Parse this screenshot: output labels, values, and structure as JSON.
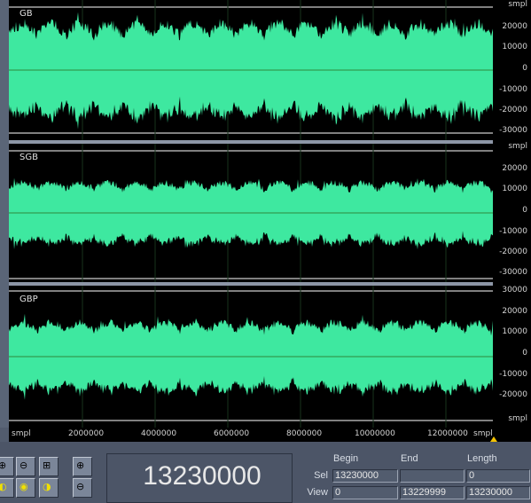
{
  "tracks": [
    {
      "label": "GB"
    },
    {
      "label": "SGB"
    },
    {
      "label": "GBP"
    }
  ],
  "right_ruler": {
    "track1": [
      "smpl",
      "20000",
      "10000",
      "0",
      "-10000",
      "-20000",
      "-30000"
    ],
    "track2": [
      "smpl",
      "20000",
      "10000",
      "0",
      "-10000",
      "-20000",
      "-30000"
    ],
    "track3": [
      "30000",
      "20000",
      "10000",
      "0",
      "-10000",
      "-20000",
      "smpl"
    ]
  },
  "bottom_ruler": [
    "smpl",
    "2000000",
    "4000000",
    "6000000",
    "8000000",
    "10000000",
    "12000000",
    "smpl"
  ],
  "counter": "13230000",
  "selection": {
    "headers": {
      "begin": "Begin",
      "end": "End",
      "length": "Length"
    },
    "sel": {
      "label": "Sel",
      "begin": "13230000",
      "end": "",
      "length": "0"
    },
    "view": {
      "label": "View",
      "begin": "0",
      "end": "13229999",
      "length": "13230000"
    }
  },
  "colors": {
    "waveform": "#3ee8a0",
    "background": "#000000",
    "centerline": "#2f8a3c",
    "gridline": "#ffffff"
  },
  "toolbar_icons": [
    "zoom-in-icon",
    "zoom-out-icon",
    "zoom-full-icon",
    "zoom-in-vertical-icon",
    "zoom-selection-left-icon",
    "zoom-selection-icon",
    "zoom-selection-right-icon",
    "zoom-out-vertical-icon"
  ]
}
